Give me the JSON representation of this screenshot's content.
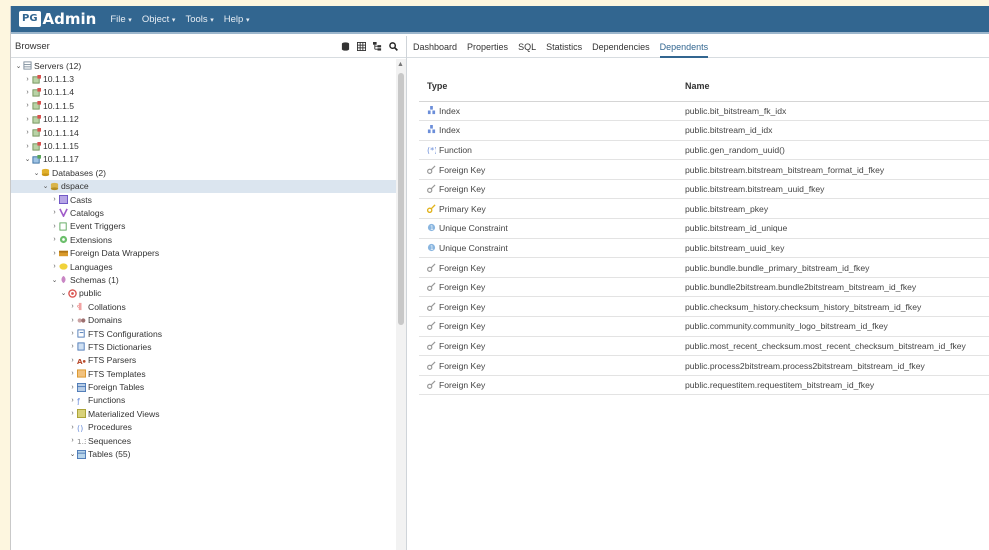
{
  "app": {
    "logo_pg": "PG",
    "logo_text": "Admin"
  },
  "menu": [
    "File",
    "Object",
    "Tools",
    "Help"
  ],
  "browser": {
    "title": "Browser"
  },
  "tabs": [
    "Dashboard",
    "Properties",
    "SQL",
    "Statistics",
    "Dependencies",
    "Dependents"
  ],
  "active_tab": "Dependents",
  "tree": [
    {
      "label": "Servers (12)",
      "depth": 0,
      "exp": "down",
      "icon": "server-group"
    },
    {
      "label": "10.1.1.3",
      "depth": 1,
      "exp": "right",
      "icon": "server-disconnected"
    },
    {
      "label": "10.1.1.4",
      "depth": 1,
      "exp": "right",
      "icon": "server-disconnected"
    },
    {
      "label": "10.1.1.5",
      "depth": 1,
      "exp": "right",
      "icon": "server-disconnected"
    },
    {
      "label": "10.1.1.12",
      "depth": 1,
      "exp": "right",
      "icon": "server-disconnected"
    },
    {
      "label": "10.1.1.14",
      "depth": 1,
      "exp": "right",
      "icon": "server-disconnected"
    },
    {
      "label": "10.1.1.15",
      "depth": 1,
      "exp": "right",
      "icon": "server-disconnected"
    },
    {
      "label": "10.1.1.17",
      "depth": 1,
      "exp": "down",
      "icon": "server"
    },
    {
      "label": "Databases (2)",
      "depth": 2,
      "exp": "down",
      "icon": "databases"
    },
    {
      "label": "dspace",
      "depth": 3,
      "exp": "down",
      "icon": "database",
      "selected": true
    },
    {
      "label": "Casts",
      "depth": 4,
      "exp": "right",
      "icon": "casts"
    },
    {
      "label": "Catalogs",
      "depth": 4,
      "exp": "right",
      "icon": "catalogs"
    },
    {
      "label": "Event Triggers",
      "depth": 4,
      "exp": "right",
      "icon": "event-triggers"
    },
    {
      "label": "Extensions",
      "depth": 4,
      "exp": "right",
      "icon": "extensions"
    },
    {
      "label": "Foreign Data Wrappers",
      "depth": 4,
      "exp": "right",
      "icon": "fdw"
    },
    {
      "label": "Languages",
      "depth": 4,
      "exp": "right",
      "icon": "languages"
    },
    {
      "label": "Schemas (1)",
      "depth": 4,
      "exp": "down",
      "icon": "schemas"
    },
    {
      "label": "public",
      "depth": 5,
      "exp": "down",
      "icon": "schema"
    },
    {
      "label": "Collations",
      "depth": 6,
      "exp": "right",
      "icon": "collations"
    },
    {
      "label": "Domains",
      "depth": 6,
      "exp": "right",
      "icon": "domains"
    },
    {
      "label": "FTS Configurations",
      "depth": 6,
      "exp": "right",
      "icon": "fts-config"
    },
    {
      "label": "FTS Dictionaries",
      "depth": 6,
      "exp": "right",
      "icon": "fts-dict"
    },
    {
      "label": "FTS Parsers",
      "depth": 6,
      "exp": "right",
      "icon": "fts-parsers"
    },
    {
      "label": "FTS Templates",
      "depth": 6,
      "exp": "right",
      "icon": "fts-templates"
    },
    {
      "label": "Foreign Tables",
      "depth": 6,
      "exp": "right",
      "icon": "foreign-tables"
    },
    {
      "label": "Functions",
      "depth": 6,
      "exp": "right",
      "icon": "functions"
    },
    {
      "label": "Materialized Views",
      "depth": 6,
      "exp": "right",
      "icon": "mat-views"
    },
    {
      "label": "Procedures",
      "depth": 6,
      "exp": "right",
      "icon": "procedures"
    },
    {
      "label": "Sequences",
      "depth": 6,
      "exp": "right",
      "icon": "sequences"
    },
    {
      "label": "Tables (55)",
      "depth": 6,
      "exp": "down",
      "icon": "tables"
    }
  ],
  "table": {
    "headers": [
      "Type",
      "Name"
    ],
    "rows": [
      {
        "type": "Index",
        "icon": "index",
        "name": "public.bit_bitstream_fk_idx"
      },
      {
        "type": "Index",
        "icon": "index",
        "name": "public.bitstream_id_idx"
      },
      {
        "type": "Function",
        "icon": "function",
        "name": "public.gen_random_uuid()"
      },
      {
        "type": "Foreign Key",
        "icon": "foreign-key",
        "name": "public.bitstream.bitstream_bitstream_format_id_fkey"
      },
      {
        "type": "Foreign Key",
        "icon": "foreign-key",
        "name": "public.bitstream.bitstream_uuid_fkey"
      },
      {
        "type": "Primary Key",
        "icon": "primary-key",
        "name": "public.bitstream_pkey"
      },
      {
        "type": "Unique Constraint",
        "icon": "unique",
        "name": "public.bitstream_id_unique"
      },
      {
        "type": "Unique Constraint",
        "icon": "unique",
        "name": "public.bitstream_uuid_key"
      },
      {
        "type": "Foreign Key",
        "icon": "foreign-key",
        "name": "public.bundle.bundle_primary_bitstream_id_fkey"
      },
      {
        "type": "Foreign Key",
        "icon": "foreign-key",
        "name": "public.bundle2bitstream.bundle2bitstream_bitstream_id_fkey"
      },
      {
        "type": "Foreign Key",
        "icon": "foreign-key",
        "name": "public.checksum_history.checksum_history_bitstream_id_fkey"
      },
      {
        "type": "Foreign Key",
        "icon": "foreign-key",
        "name": "public.community.community_logo_bitstream_id_fkey"
      },
      {
        "type": "Foreign Key",
        "icon": "foreign-key",
        "name": "public.most_recent_checksum.most_recent_checksum_bitstream_id_fkey"
      },
      {
        "type": "Foreign Key",
        "icon": "foreign-key",
        "name": "public.process2bitstream.process2bitstream_bitstream_id_fkey"
      },
      {
        "type": "Foreign Key",
        "icon": "foreign-key",
        "name": "public.requestitem.requestitem_bitstream_id_fkey"
      }
    ]
  },
  "colors": {
    "topbar": "#326690",
    "accent": "#326690",
    "selected": "#dbe5ef"
  }
}
